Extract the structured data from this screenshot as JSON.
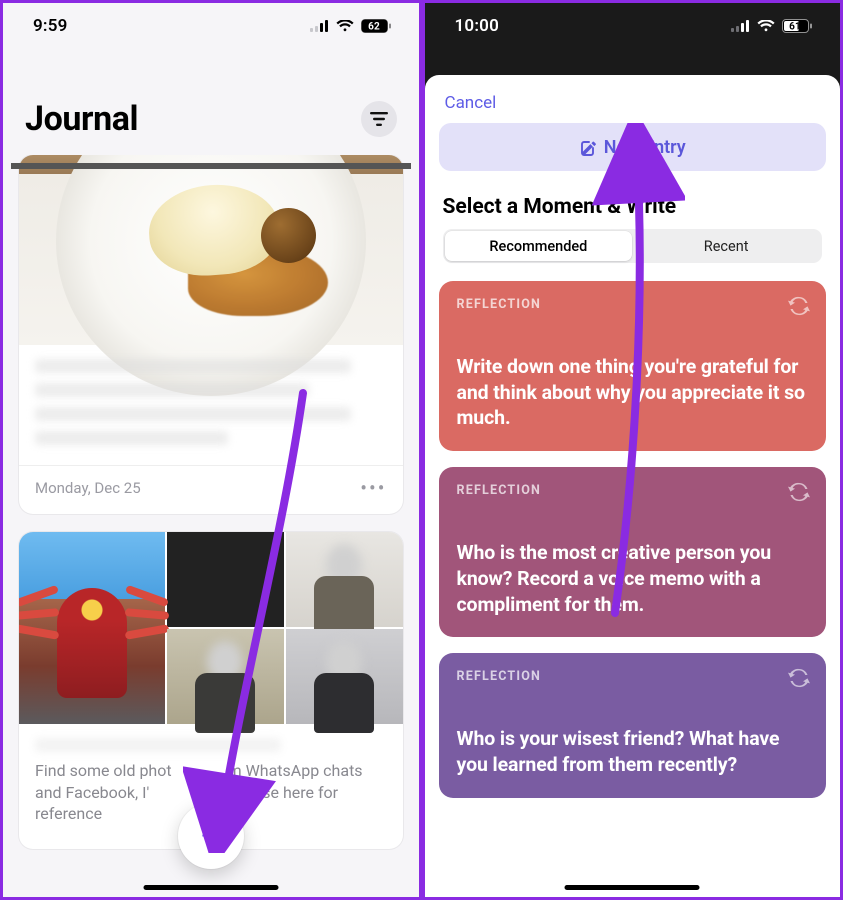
{
  "left": {
    "time": "9:59",
    "battery": "62",
    "title": "Journal",
    "entry_date": "Monday, Dec 25",
    "gallery_caption_line1": "Find some old phot",
    "gallery_caption_line2": "m WhatsApp chats",
    "gallery_caption_line3": "and Facebook, I'",
    "gallery_caption_line4": "ng those here for",
    "gallery_caption_line5": "reference",
    "fab_glyph": "+"
  },
  "right": {
    "time": "10:00",
    "battery": "61",
    "cancel": "Cancel",
    "new_entry": "New Entry",
    "section_title": "Select a Moment & Write",
    "tab_recommended": "Recommended",
    "tab_recent": "Recent",
    "reflection_label": "REFLECTION",
    "prompts": {
      "p1": "Write down one thing you're grateful for and think about why you appreciate it so much.",
      "p2": "Who is the most creative person you know? Record a voice memo with a compliment for them.",
      "p3": "Who is your wisest friend? What have you learned from them recently?"
    }
  }
}
